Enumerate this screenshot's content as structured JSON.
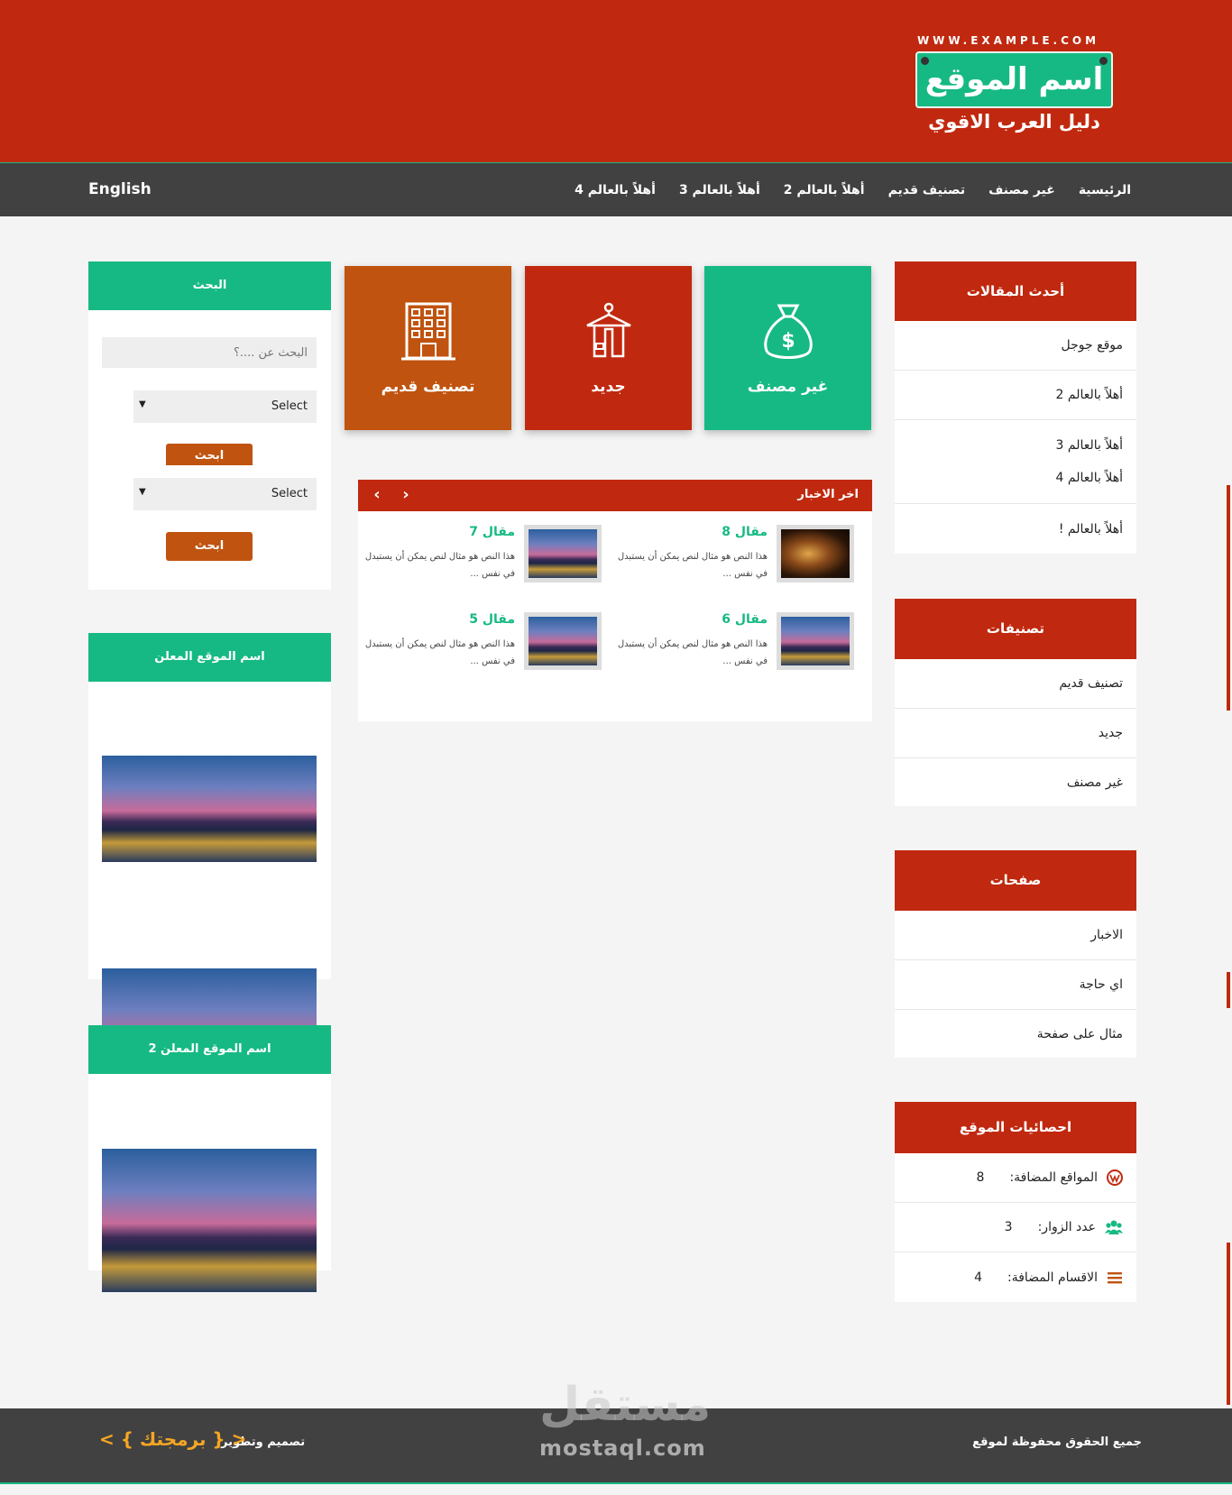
{
  "header": {
    "url_text": "WWW.EXAMPLE.COM",
    "site_name": "اسم الموقع",
    "tagline": "دليل العرب الاقوي"
  },
  "nav": {
    "items": [
      "الرئيسية",
      "غير مصنف",
      "تصنيف قديم",
      "أهلاً بالعالم 2",
      "أهلاً بالعالم 3",
      "أهلاً بالعالم 4"
    ],
    "language": "English"
  },
  "latest_posts": {
    "title": "أحدث المقالات",
    "items": [
      "موقع جوجل",
      "أهلاً بالعالم 2",
      "أهلاً بالعالم 3",
      "أهلاً بالعالم 4",
      "أهلاً بالعالم !"
    ]
  },
  "categories": {
    "title": "تصنيفات",
    "items": [
      "تصنيف قديم",
      "جديد",
      "غير مصنف"
    ]
  },
  "pages": {
    "title": "صفحات",
    "items": [
      "الاخبار",
      "اي حاجة",
      "مثال على صفحة"
    ]
  },
  "stats": {
    "title": "احصائيات الموقع",
    "items": [
      {
        "icon": "wordpress-icon",
        "label": "المواقع المضافة:",
        "value": "8"
      },
      {
        "icon": "users-icon",
        "label": "عدد الزوار:",
        "value": "3"
      },
      {
        "icon": "list-icon",
        "label": "الاقسام المضافة:",
        "value": "4"
      }
    ]
  },
  "tiles": [
    {
      "icon": "money-bag-icon",
      "label": "غير مصنف",
      "color": "#16b983"
    },
    {
      "icon": "hanger-icon",
      "label": "جديد",
      "color": "#c0290f"
    },
    {
      "icon": "building-icon",
      "label": "تصنيف قديم",
      "color": "#c0530f"
    }
  ],
  "news": {
    "title": "اخر الاخبار",
    "items": [
      {
        "title": "مقال 8",
        "excerpt": "هذا النص هو مثال لنص يمكن أن يستبدل في نفس ..."
      },
      {
        "title": "مقال 7",
        "excerpt": "هذا النص هو مثال لنص يمكن أن يستبدل في نفس ..."
      },
      {
        "title": "مقال 6",
        "excerpt": "هذا النص هو مثال لنص يمكن أن يستبدل في نفس ..."
      },
      {
        "title": "مقال 5",
        "excerpt": "هذا النص هو مثال لنص يمكن أن يستبدل في نفس ..."
      }
    ]
  },
  "search": {
    "title": "البحث",
    "placeholder": "البحث عن ....؟",
    "select_value": "Select",
    "button": "ابحث"
  },
  "ads": [
    {
      "title": "اسم الموقع المعلن"
    },
    {
      "title": "اسم الموقع المعلن 2"
    }
  ],
  "footer": {
    "copyright": "جميع الحقوق محفوظة لموقع",
    "credit": "تصميم وتطوير",
    "brand": "< { برمجتك } >"
  },
  "watermark": {
    "arabic": "مستقل",
    "latin": "mostaql.com"
  },
  "colors": {
    "primary_red": "#c0290f",
    "accent_green": "#16b983",
    "accent_orange": "#c0530f",
    "nav_dark": "#414141"
  }
}
